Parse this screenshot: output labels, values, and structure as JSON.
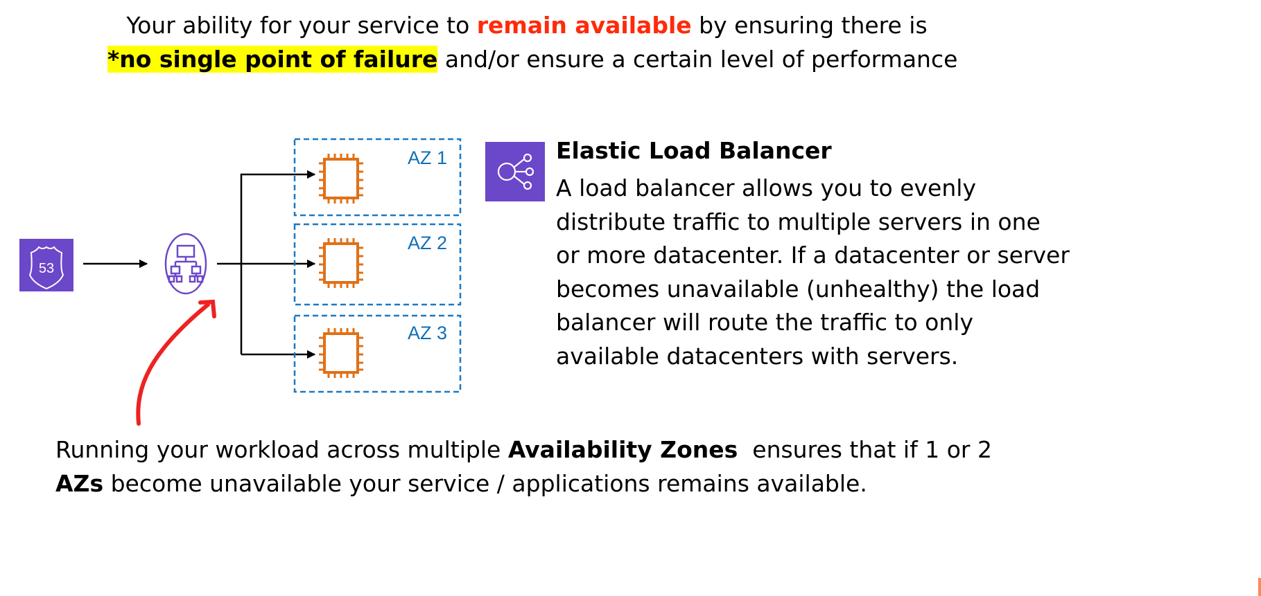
{
  "heading": {
    "line1_prefix": "Your ability for your service to ",
    "line1_emphasis": "remain available",
    "line1_suffix": " by ensuring there is",
    "line2_highlight": "*no single point of failure",
    "line2_suffix": " and/or ensure a certain level of performance"
  },
  "diagram": {
    "route53_label": "53",
    "az_labels": [
      "AZ 1",
      "AZ 2",
      "AZ 3"
    ],
    "colors": {
      "aws_purple": "#6b47c9",
      "ec2_orange": "#e07116",
      "az_border": "#1a78c2",
      "annotation_red": "#ee2222"
    },
    "icons": [
      "route53-icon",
      "load-balancer-icon",
      "ec2-instance-icon",
      "elastic-load-balancer-icon"
    ]
  },
  "elb": {
    "title": "Elastic Load Balancer",
    "lines": [
      "A load balancer allows you to evenly",
      "distribute traffic to multiple servers in one",
      "or more datacenter. If a datacenter or server",
      "becomes unavailable (unhealthy) the load",
      "balancer will route the traffic to only",
      "available datacenters with servers."
    ]
  },
  "footer": {
    "line1_prefix": "Running your workload across multiple ",
    "line1_bold": "Availability Zones",
    "line1_suffix": "  ensures that if 1 or 2",
    "line2_bold": "AZs",
    "line2_suffix": " become unavailable your service / applications remains available."
  }
}
